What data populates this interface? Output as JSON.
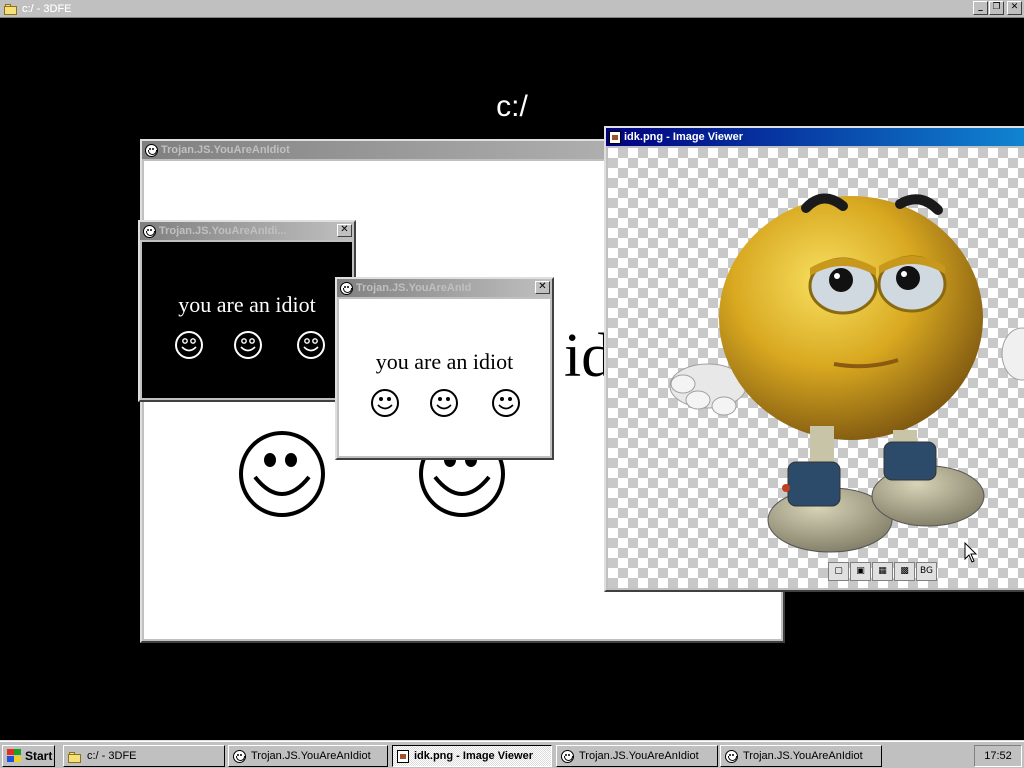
{
  "explorer": {
    "title": "c:/ - 3DFE",
    "path_label": "c:/",
    "controls": {
      "minimize": "_",
      "restore": "❐",
      "close": "✕"
    }
  },
  "windows": {
    "idiot_large": {
      "title": "Trojan.JS.YouAreAnIdiot",
      "big_text": "idiot"
    },
    "idiot_black": {
      "title": "Trojan.JS.YouAreAnIdi...",
      "text": "you are an idiot",
      "close": "✕"
    },
    "idiot_white": {
      "title": "Trojan.JS.YouAreAnId",
      "text": "you are an idiot",
      "close": "✕"
    },
    "image_viewer": {
      "title": "idk.png - Image Viewer",
      "toolbar": [
        "",
        "",
        "",
        "",
        "BG"
      ]
    }
  },
  "taskbar": {
    "start": "Start",
    "items": [
      {
        "label": "c:/ - 3DFE",
        "icon": "folder-icon",
        "active": false
      },
      {
        "label": "Trojan.JS.YouAreAnIdiot",
        "icon": "smiley-icon",
        "active": false
      },
      {
        "label": "idk.png - Image Viewer",
        "icon": "image-viewer-icon",
        "active": true
      },
      {
        "label": "Trojan.JS.YouAreAnIdiot",
        "icon": "smiley-icon",
        "active": false
      },
      {
        "label": "Trojan.JS.YouAreAnIdiot",
        "icon": "smiley-icon",
        "active": false
      }
    ],
    "clock": "17:52"
  },
  "colors": {
    "desktop": "#000000",
    "face_button": "#c0c0c0",
    "active_title": "#000080",
    "inactive_title": "#808080"
  }
}
